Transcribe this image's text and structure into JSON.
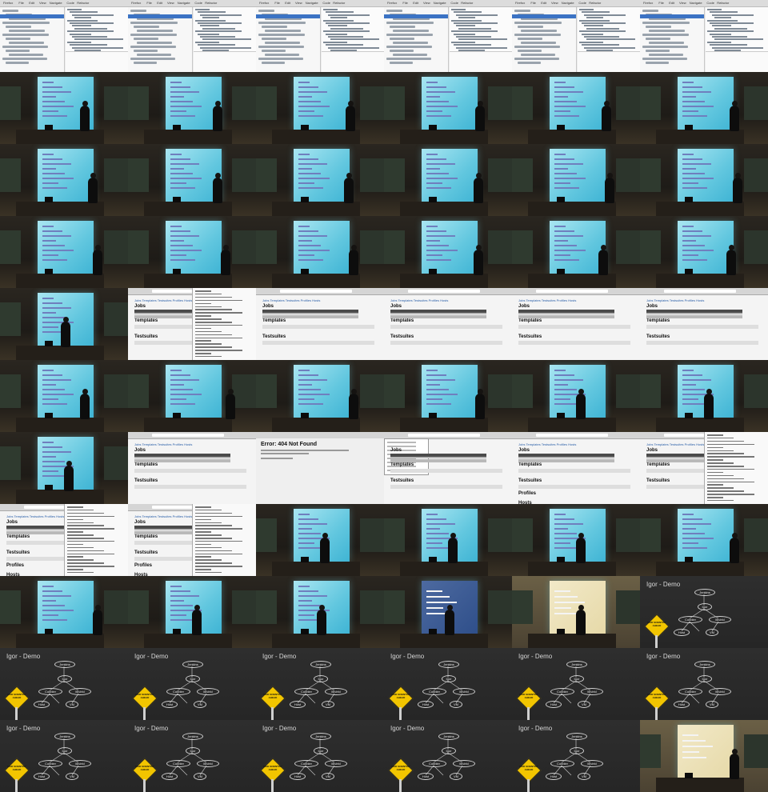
{
  "contact_sheet": {
    "columns": 6,
    "rows": 11,
    "cells": [
      {
        "kind": "ide"
      },
      {
        "kind": "ide"
      },
      {
        "kind": "ide"
      },
      {
        "kind": "ide"
      },
      {
        "kind": "ide"
      },
      {
        "kind": "ide"
      },
      {
        "kind": "room",
        "p": [
          100,
          128
        ]
      },
      {
        "kind": "room",
        "p": [
          266,
          132
        ]
      },
      {
        "kind": "room",
        "p": [
          432,
          128
        ]
      },
      {
        "kind": "room",
        "p": [
          594,
          128
        ]
      },
      {
        "kind": "room",
        "p": [
          752,
          128
        ]
      },
      {
        "kind": "room",
        "p": [
          912,
          128
        ]
      },
      {
        "kind": "room",
        "p": [
          110,
          128
        ]
      },
      {
        "kind": "room",
        "p": [
          266,
          132
        ]
      },
      {
        "kind": "room",
        "p": [
          430,
          128
        ]
      },
      {
        "kind": "room",
        "p": [
          592,
          128
        ]
      },
      {
        "kind": "room",
        "p": [
          756,
          128
        ]
      },
      {
        "kind": "room",
        "p": [
          916,
          128
        ]
      },
      {
        "kind": "room",
        "p": [
          116,
          128
        ]
      },
      {
        "kind": "room",
        "p": [
          276,
          132
        ]
      },
      {
        "kind": "room",
        "p": [
          436,
          128
        ]
      },
      {
        "kind": "room",
        "p": [
          592,
          128
        ]
      },
      {
        "kind": "room",
        "p": [
          748,
          128
        ]
      },
      {
        "kind": "room",
        "p": [
          908,
          128
        ]
      },
      {
        "kind": "room",
        "p": [
          76,
          128
        ]
      },
      {
        "kind": "browser",
        "variant": "jobs-split"
      },
      {
        "kind": "browser",
        "variant": "jobs"
      },
      {
        "kind": "browser",
        "variant": "jobs"
      },
      {
        "kind": "browser",
        "variant": "jobs"
      },
      {
        "kind": "browser",
        "variant": "jobs"
      },
      {
        "kind": "room",
        "p": [
          100,
          128
        ]
      },
      {
        "kind": "room",
        "p": [
          282,
          132
        ]
      },
      {
        "kind": "room",
        "p": [
          436,
          128
        ]
      },
      {
        "kind": "room",
        "p": [
          594,
          128
        ]
      },
      {
        "kind": "room",
        "p": [
          720,
          128
        ]
      },
      {
        "kind": "room",
        "p": [
          880,
          128
        ]
      },
      {
        "kind": "room",
        "p": [
          80,
          128
        ]
      },
      {
        "kind": "browser",
        "variant": "jobs"
      },
      {
        "kind": "error"
      },
      {
        "kind": "browser",
        "variant": "menu"
      },
      {
        "kind": "browser",
        "variant": "jobs-long"
      },
      {
        "kind": "browser",
        "variant": "jobs-term"
      },
      {
        "kind": "browser",
        "variant": "jobs-term2"
      },
      {
        "kind": "browser",
        "variant": "jobs-term2"
      },
      {
        "kind": "room",
        "p": [
          400,
          128
        ]
      },
      {
        "kind": "room",
        "p": [
          560,
          128
        ]
      },
      {
        "kind": "room",
        "p": [
          720,
          128
        ]
      },
      {
        "kind": "room",
        "p": [
          912,
          128
        ]
      },
      {
        "kind": "room",
        "p": [
          116,
          128
        ]
      },
      {
        "kind": "room",
        "p": [
          240,
          132
        ]
      },
      {
        "kind": "room",
        "p": [
          396,
          128
        ]
      },
      {
        "kind": "room",
        "tone": "warm",
        "p": [
          556,
          128
        ]
      },
      {
        "kind": "room",
        "tone": "cream",
        "p": [
          720,
          128
        ]
      },
      {
        "kind": "slide"
      },
      {
        "kind": "slide"
      },
      {
        "kind": "slide"
      },
      {
        "kind": "slide"
      },
      {
        "kind": "slide"
      },
      {
        "kind": "slide"
      },
      {
        "kind": "slide"
      },
      {
        "kind": "slide"
      },
      {
        "kind": "slide"
      },
      {
        "kind": "slide"
      },
      {
        "kind": "slide"
      },
      {
        "kind": "slide"
      },
      {
        "kind": "room",
        "tone": "cream",
        "p": [
          912,
          128
        ]
      }
    ]
  },
  "ide": {
    "menu": [
      "Firefox",
      "File",
      "Edit",
      "View",
      "Navigate",
      "Code",
      "Refactor"
    ]
  },
  "browser": {
    "nav_links": "Jobs  Templates  Testsuites  Profiles  Hosts",
    "heading_jobs": "Jobs",
    "heading_templates": "Templates",
    "heading_testsuites": "Testsuites",
    "heading_profiles": "Profiles",
    "heading_hosts": "Hosts"
  },
  "error_page": {
    "title": "Error: 404 Not Found"
  },
  "slide": {
    "title": "Igor - Demo",
    "nodes": {
      "top": "Jenkins",
      "mid": "Igor",
      "left": "Cobbler",
      "right": "libvirtd",
      "bottom_left": "Host",
      "bottom_right": "VM"
    },
    "sign_text": "MAD SCIENTIST AHEAD"
  },
  "colors": {
    "projector": "#5ec6df",
    "selection": "#3b73c4",
    "slide_bg": "#2a2a2a",
    "sign": "#f2c500"
  }
}
